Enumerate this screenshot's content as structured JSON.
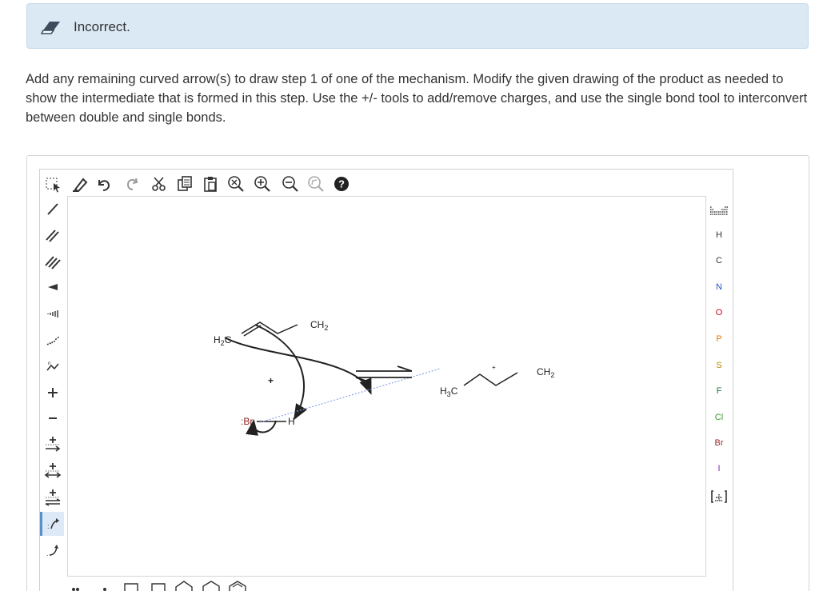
{
  "feedback": {
    "status": "Incorrect.",
    "icon": "eraser-icon"
  },
  "question": {
    "text": "Add any remaining curved arrow(s) to draw step 1 of one of the mechanism. Modify the given drawing of the product as needed to show the intermediate that is formed in this step. Use the +/- tools to add/remove charges, and use the single bond tool to interconvert between double and single bonds."
  },
  "toolbar_top": [
    "select-icon",
    "erase-icon",
    "undo-icon",
    "redo-icon",
    "cut-icon",
    "copy-icon",
    "paste-icon",
    "zoom-reset-icon",
    "zoom-in-icon",
    "zoom-out-icon",
    "clean-icon",
    "help-icon"
  ],
  "toolbar_left": [
    "single-bond-icon",
    "double-bond-icon",
    "triple-bond-icon",
    "wedge-bond-icon",
    "hash-bond-icon",
    "wavy-bond-icon",
    "chain-icon",
    "plus-charge-icon",
    "minus-charge-icon",
    "plus-arrow-icon",
    "plus-equilibrium-icon",
    "plus-resonance-icon",
    "curved-arrow-pair-icon",
    "curved-arrow-single-icon"
  ],
  "atoms": {
    "h": "H",
    "c": "C",
    "n": "N",
    "o": "O",
    "p": "P",
    "s": "S",
    "f": "F",
    "cl": "Cl",
    "br": "Br",
    "i": "I"
  },
  "molecule": {
    "reactant_h3c_main": "H",
    "reactant_h3c_sub": "2",
    "reactant_h3c_c": "C",
    "reactant_ch2_c": "CH",
    "reactant_ch2_sub": "2",
    "plus": "+",
    "hbr_br": ":Br",
    "hbr_h": "H",
    "product_h3c_main": "H",
    "product_h3c_sub": "3",
    "product_h3c_c": "C",
    "product_ch2_c": "CH",
    "product_ch2_sub": "2",
    "product_charge": "+"
  },
  "colors": {
    "feedback_bg": "#dbe9f5",
    "arrow_color": "#222222",
    "dotted_line": "#8fa6e8",
    "bromine_color": "#8a1a1a",
    "selected_tool_bg": "#dde9f6"
  }
}
